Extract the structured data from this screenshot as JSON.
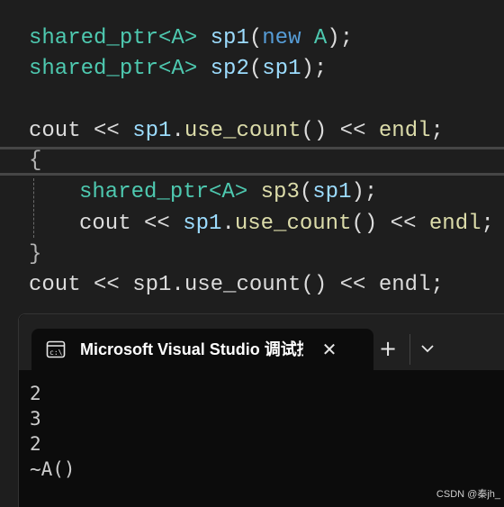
{
  "code": {
    "line1": {
      "type": "shared_ptr<A>",
      "var": "sp1",
      "open": "(",
      "kw": "new",
      "arg": "A",
      "close": ");"
    },
    "line2": {
      "type": "shared_ptr<A>",
      "var": "sp2",
      "open": "(",
      "arg": "sp1",
      "close": ");"
    },
    "line3": {
      "cout": "cout << ",
      "var": "sp1",
      "dot": ".",
      "fn": "use_count",
      "rest": "() << ",
      "endl": "endl",
      "semi": ";"
    },
    "line4": {
      "brace": "{"
    },
    "line5": {
      "type": "shared_ptr<A>",
      "var": "sp3",
      "open": "(",
      "arg": "sp1",
      "close": ");"
    },
    "line6": {
      "cout": "cout << ",
      "var": "sp1",
      "dot": ".",
      "fn": "use_count",
      "rest": "() << ",
      "endl": "endl",
      "semi": ";"
    },
    "line7": {
      "brace": "}"
    },
    "line8": {
      "text": "cout << sp1.use_count() << endl;"
    }
  },
  "terminal": {
    "tab_title": "Microsoft Visual Studio 调试控制台",
    "close_symbol": "✕",
    "new_tab_symbol": "+",
    "output_lines": [
      "2",
      "3",
      "2",
      "~A()"
    ]
  },
  "watermark": "CSDN @秦jh_",
  "colors": {
    "editor_bg": "#1e1e1e",
    "type": "#4ec9b0",
    "variable": "#9cdcfe",
    "keyword": "#569cd6",
    "function": "#dcdcaa",
    "terminal_bg": "#0c0c0c"
  }
}
